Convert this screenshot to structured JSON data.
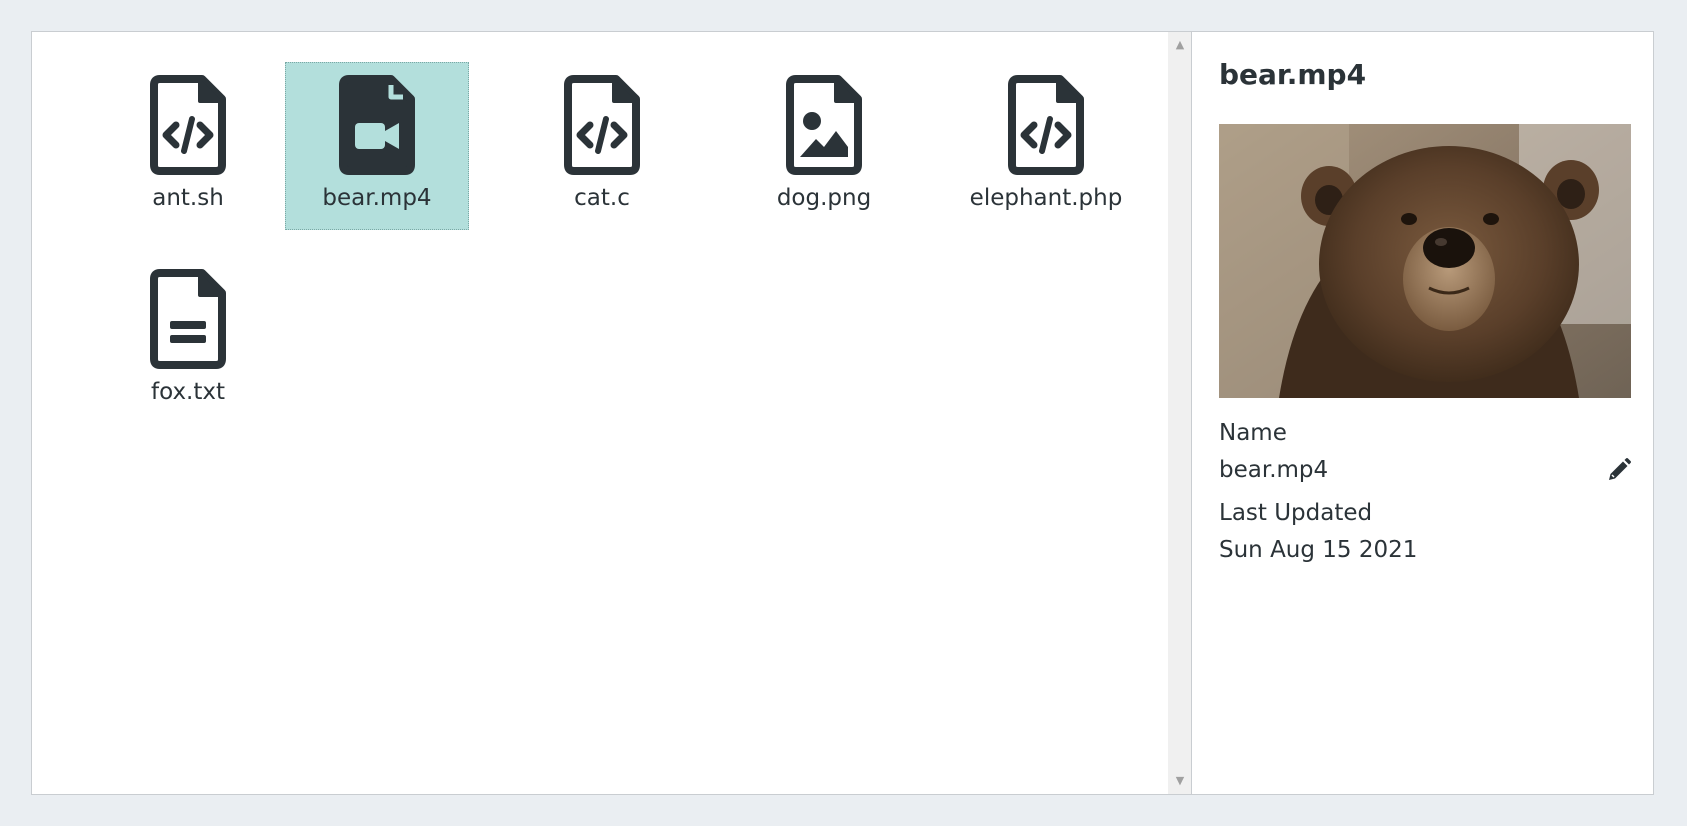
{
  "files": [
    {
      "name": "ant.sh",
      "icon": "file-code-icon"
    },
    {
      "name": "bear.mp4",
      "icon": "file-video-icon"
    },
    {
      "name": "cat.c",
      "icon": "file-code-icon"
    },
    {
      "name": "dog.png",
      "icon": "file-image-icon"
    },
    {
      "name": "elephant.php",
      "icon": "file-code-icon"
    },
    {
      "name": "fox.txt",
      "icon": "file-text-icon"
    }
  ],
  "selected_file": "bear.mp4",
  "details": {
    "title": "bear.mp4",
    "name_label": "Name",
    "name_value": "bear.mp4",
    "updated_label": "Last Updated",
    "updated_value": "Sun Aug 15 2021",
    "edit_icon": "pencil-icon"
  },
  "colors": {
    "selection": "#b3dfdc",
    "icon": "#2b3338",
    "background": "#eaeef2"
  }
}
